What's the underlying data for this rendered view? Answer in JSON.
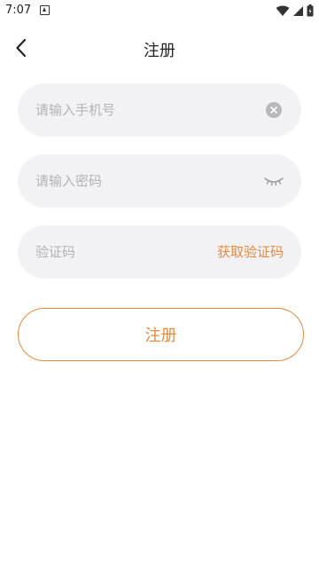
{
  "status_bar": {
    "time": "7:07",
    "icons": [
      "notification-icon",
      "wifi-icon",
      "signal-icon",
      "battery-icon"
    ]
  },
  "header": {
    "title": "注册",
    "back_icon": "chevron-left-icon"
  },
  "form": {
    "phone": {
      "placeholder": "请输入手机号",
      "value": "",
      "clear_icon": "clear-icon"
    },
    "password": {
      "placeholder": "请输入密码",
      "value": "",
      "toggle_icon": "eye-closed-icon"
    },
    "code": {
      "placeholder": "验证码",
      "value": "",
      "get_code_label": "获取验证码"
    },
    "submit_label": "注册"
  },
  "colors": {
    "accent": "#e58a3f",
    "field_background": "#f2f2f4",
    "placeholder": "#b3b3b3"
  }
}
